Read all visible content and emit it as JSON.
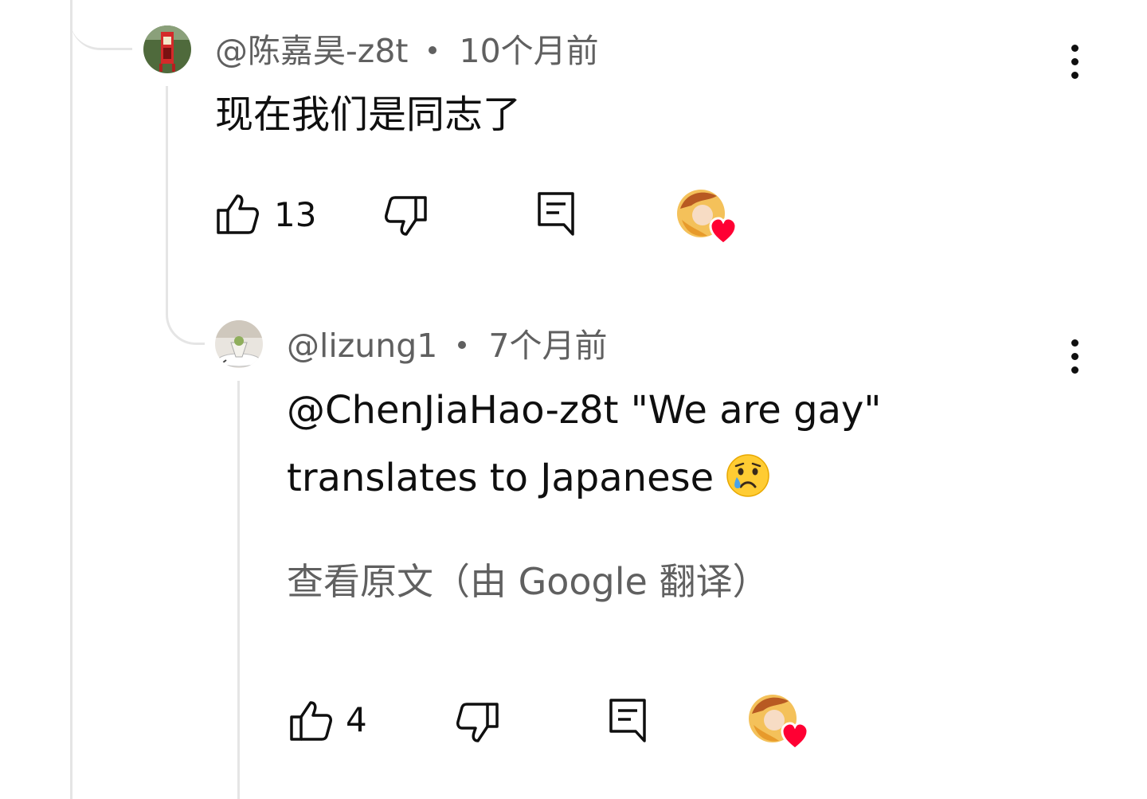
{
  "comments": [
    {
      "author": "@陈嘉昊-z8t",
      "time": "10个月前",
      "text": "现在我们是同志了",
      "likes": "13",
      "avatar_icon": "red-booth-photo",
      "creator_heart": true
    },
    {
      "author": "@lizung1",
      "time": "7个月前",
      "text_line1": "@ChenJiaHao-z8t \"We are gay\"",
      "text_line2": "translates to Japanese",
      "emoji_icon": "crying-face-icon",
      "translate_link": "查看原文（由 Google 翻译）",
      "likes": "4",
      "avatar_icon": "dessert-cup-photo",
      "creator_heart": true
    }
  ],
  "colors": {
    "text_primary": "#0f0f0f",
    "text_secondary": "#606060",
    "thread_line": "#e5e5e5",
    "heart": "#ff0033"
  }
}
